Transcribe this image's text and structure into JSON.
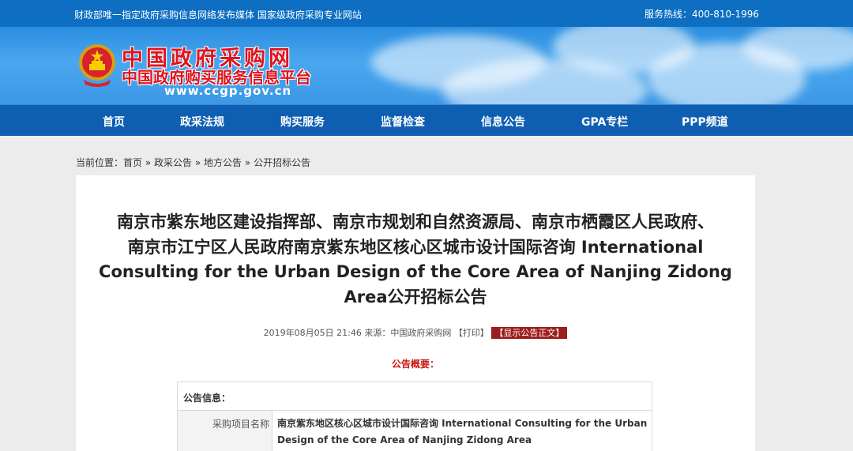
{
  "topbar": {
    "left_text": "财政部唯一指定政府采购信息网络发布媒体 国家级政府采购专业网站",
    "hotline": "服务热线：400-810-1996"
  },
  "banner": {
    "title_cn": "中国政府采购网",
    "title_sub": "中国政府购买服务信息平台",
    "url": "www.ccgp.gov.cn"
  },
  "nav": {
    "items": [
      {
        "label": "首页"
      },
      {
        "label": "政采法规"
      },
      {
        "label": "购买服务"
      },
      {
        "label": "监督检查"
      },
      {
        "label": "信息公告"
      },
      {
        "label": "GPA专栏"
      },
      {
        "label": "PPP频道"
      }
    ]
  },
  "breadcrumb": {
    "prefix": "当前位置：",
    "items": [
      "首页",
      "政采公告",
      "地方公告",
      "公开招标公告"
    ],
    "separator": "»"
  },
  "article": {
    "title_lines": [
      "南京市紫东地区建设指挥部、南京市规划和自然资源局、南京市栖霞区人民政府、",
      "南京市江宁区人民政府南京紫东地区核心区城市设计国际咨询 International",
      "Consulting for the Urban Design of the Core Area of Nanjing Zidong",
      "Area公开招标公告"
    ],
    "date": "2019年08月05日 21:46",
    "source": "来源：中国政府采购网",
    "print": "【打印】",
    "show_body": "【显示公告正文】",
    "summary_label": "公告概要：",
    "info_header": "公告信息：",
    "project_label": "采购项目名称",
    "project_value": "南京紫东地区核心区城市设计国际咨询 International Consulting for the Urban Design of the Core Area of Nanjing Zidong Area"
  },
  "colors": {
    "topbar": "#0d6ec2",
    "nav": "#0e5fb2",
    "title_red": "#e0141e",
    "summary_red": "#c81717"
  }
}
